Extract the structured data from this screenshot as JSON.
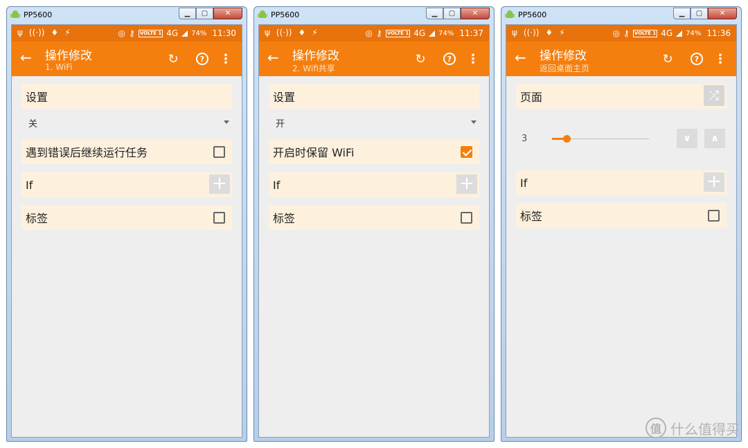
{
  "windows": [
    {
      "title": "PP5600",
      "status": {
        "time": "11:30",
        "battery": "74%",
        "network": "4G",
        "volte": "VOLTE 1"
      },
      "appbar": {
        "title": "操作修改",
        "subtitle": "1. WiFi"
      },
      "setting_label": "设置",
      "dropdown_value": "关",
      "checkbox_row_label": "遇到错误后继续运行任务",
      "checkbox_row_checked": false,
      "if_label": "If",
      "tag_label": "标签"
    },
    {
      "title": "PP5600",
      "status": {
        "time": "11:37",
        "battery": "74%",
        "network": "4G",
        "volte": "VOLTE 1"
      },
      "appbar": {
        "title": "操作修改",
        "subtitle": "2. Wifi共享"
      },
      "setting_label": "设置",
      "dropdown_value": "开",
      "checkbox_row_label": "开启时保留 WiFi",
      "checkbox_row_checked": true,
      "if_label": "If",
      "tag_label": "标签"
    },
    {
      "title": "PP5600",
      "status": {
        "time": "11:36",
        "battery": "74%",
        "network": "4G",
        "volte": "VOLTE 1"
      },
      "appbar": {
        "title": "操作修改",
        "subtitle": "返回桌面主页"
      },
      "page_label": "页面",
      "slider_value": "3",
      "slider_fraction": 0.15,
      "if_label": "If",
      "tag_label": "标签"
    }
  ],
  "watermark": {
    "text": "什么值得买",
    "logo": "值"
  },
  "colors": {
    "accent": "#f47f0e",
    "status_bar": "#e8720b",
    "row_bg": "#fdf1de"
  }
}
